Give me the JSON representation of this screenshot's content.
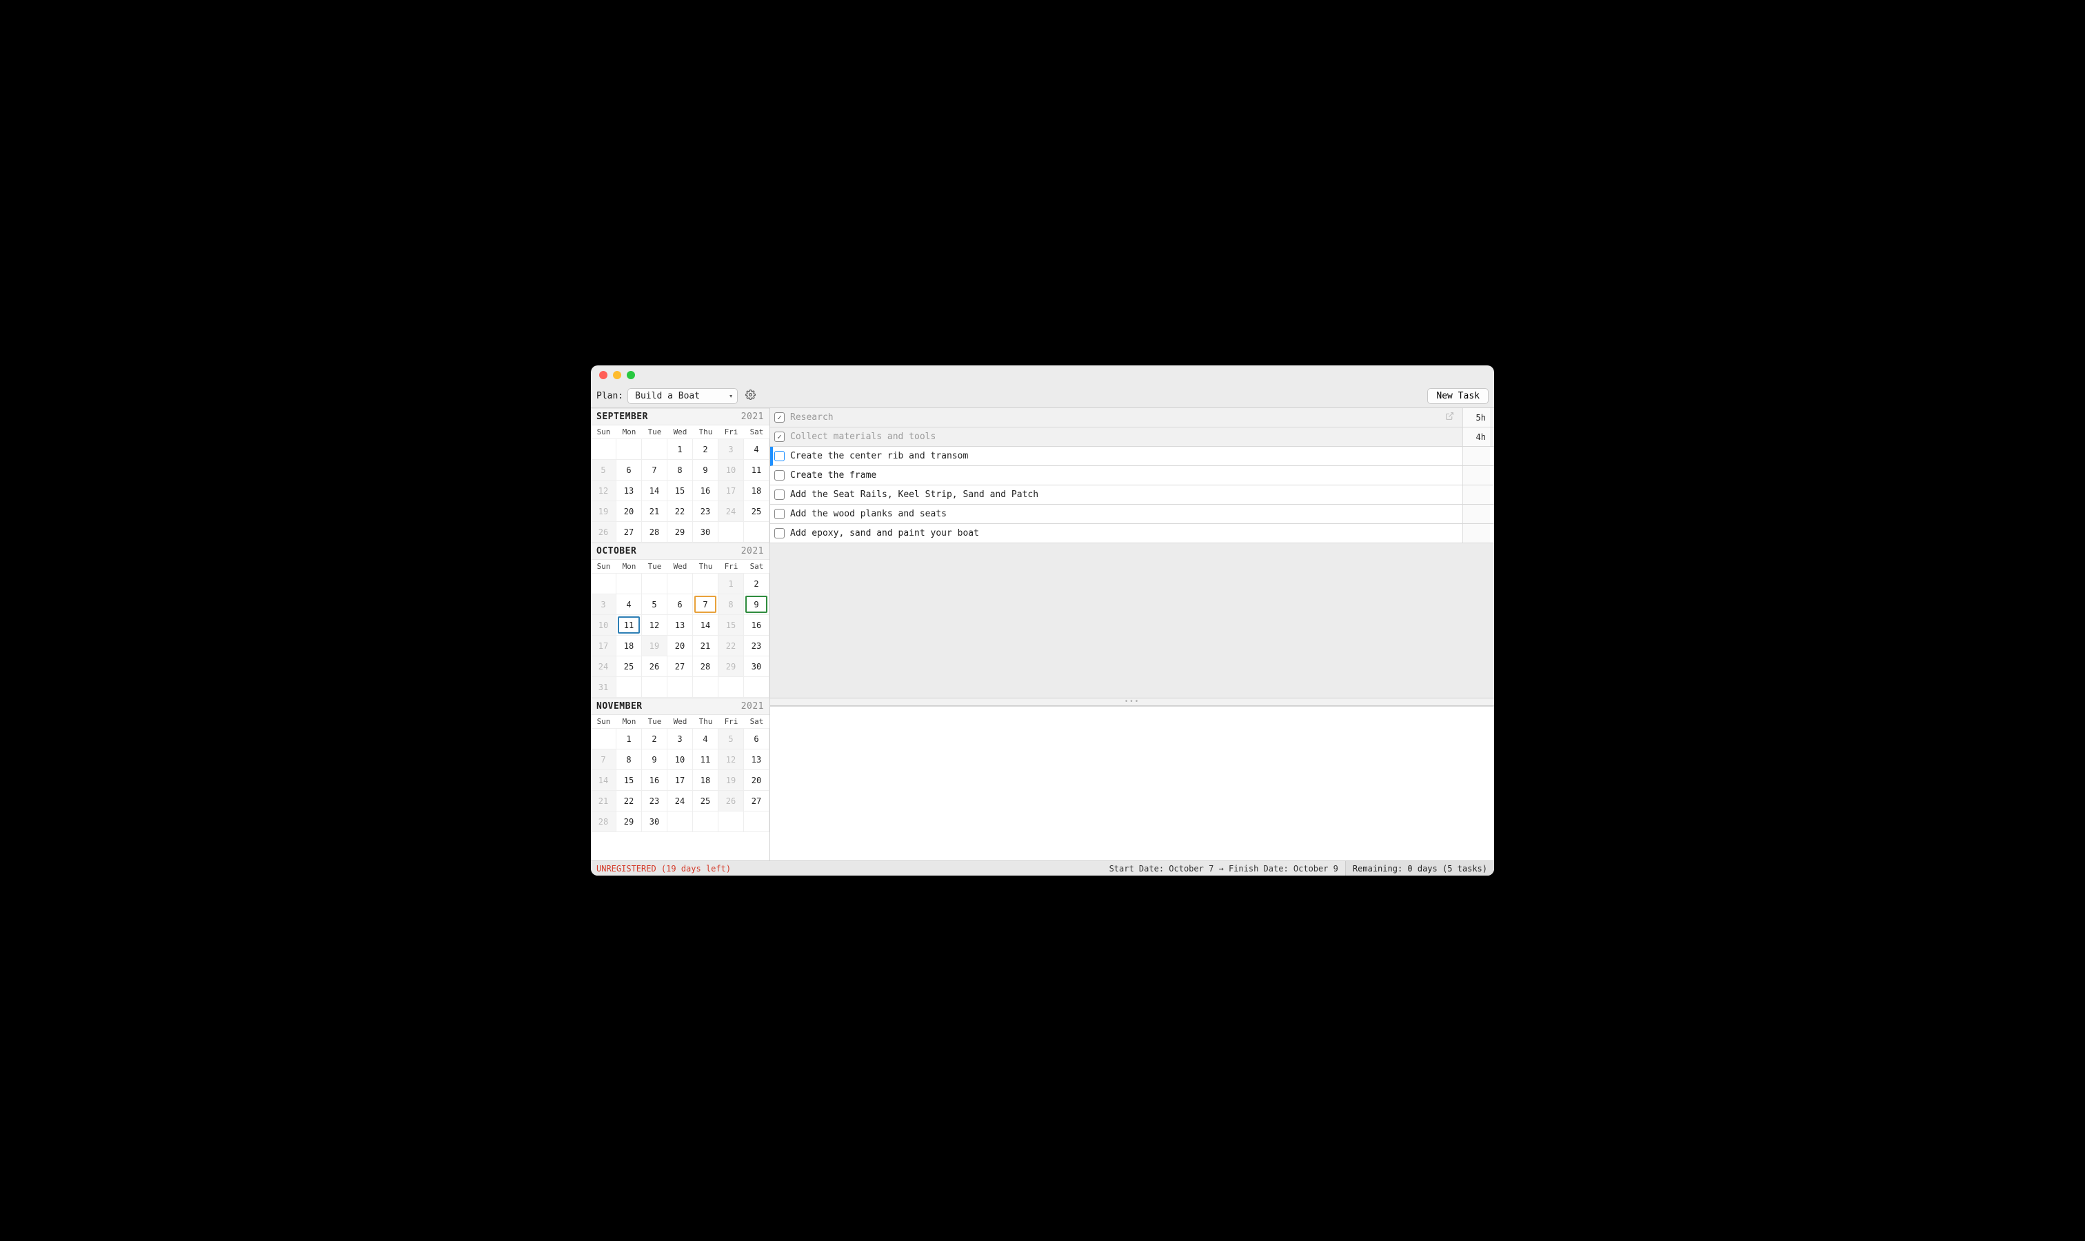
{
  "toolbar": {
    "plan_label": "Plan:",
    "plan_selected": "Build a Boat",
    "new_task_label": "New Task"
  },
  "dow": [
    "Sun",
    "Mon",
    "Tue",
    "Wed",
    "Thu",
    "Fri",
    "Sat"
  ],
  "months": [
    {
      "name": "SEPTEMBER",
      "year": "2021",
      "weeks": [
        [
          {
            "d": "",
            "cls": "empty"
          },
          {
            "d": "",
            "cls": "empty"
          },
          {
            "d": "",
            "cls": "empty"
          },
          {
            "d": "1"
          },
          {
            "d": "2"
          },
          {
            "d": "3",
            "cls": "dim"
          },
          {
            "d": "4"
          }
        ],
        [
          {
            "d": "5",
            "cls": "dim"
          },
          {
            "d": "6"
          },
          {
            "d": "7"
          },
          {
            "d": "8"
          },
          {
            "d": "9"
          },
          {
            "d": "10",
            "cls": "dim"
          },
          {
            "d": "11"
          }
        ],
        [
          {
            "d": "12",
            "cls": "dim"
          },
          {
            "d": "13"
          },
          {
            "d": "14"
          },
          {
            "d": "15"
          },
          {
            "d": "16"
          },
          {
            "d": "17",
            "cls": "dim"
          },
          {
            "d": "18"
          }
        ],
        [
          {
            "d": "19",
            "cls": "dim"
          },
          {
            "d": "20"
          },
          {
            "d": "21"
          },
          {
            "d": "22"
          },
          {
            "d": "23"
          },
          {
            "d": "24",
            "cls": "dim"
          },
          {
            "d": "25"
          }
        ],
        [
          {
            "d": "26",
            "cls": "dim"
          },
          {
            "d": "27"
          },
          {
            "d": "28"
          },
          {
            "d": "29"
          },
          {
            "d": "30"
          },
          {
            "d": "",
            "cls": "empty"
          },
          {
            "d": "",
            "cls": "empty"
          }
        ]
      ]
    },
    {
      "name": "OCTOBER",
      "year": "2021",
      "weeks": [
        [
          {
            "d": "",
            "cls": "empty"
          },
          {
            "d": "",
            "cls": "empty"
          },
          {
            "d": "",
            "cls": "empty"
          },
          {
            "d": "",
            "cls": "empty"
          },
          {
            "d": "",
            "cls": "empty"
          },
          {
            "d": "1",
            "cls": "dim"
          },
          {
            "d": "2"
          }
        ],
        [
          {
            "d": "3",
            "cls": "dim"
          },
          {
            "d": "4"
          },
          {
            "d": "5"
          },
          {
            "d": "6"
          },
          {
            "d": "7",
            "cls": "hl-orange"
          },
          {
            "d": "8",
            "cls": "dim"
          },
          {
            "d": "9",
            "cls": "hl-green"
          }
        ],
        [
          {
            "d": "10",
            "cls": "dim"
          },
          {
            "d": "11",
            "cls": "hl-blue"
          },
          {
            "d": "12"
          },
          {
            "d": "13"
          },
          {
            "d": "14"
          },
          {
            "d": "15",
            "cls": "dim"
          },
          {
            "d": "16"
          }
        ],
        [
          {
            "d": "17",
            "cls": "dim"
          },
          {
            "d": "18"
          },
          {
            "d": "19",
            "cls": "dim"
          },
          {
            "d": "20"
          },
          {
            "d": "21"
          },
          {
            "d": "22",
            "cls": "dim"
          },
          {
            "d": "23"
          }
        ],
        [
          {
            "d": "24",
            "cls": "dim"
          },
          {
            "d": "25"
          },
          {
            "d": "26"
          },
          {
            "d": "27"
          },
          {
            "d": "28"
          },
          {
            "d": "29",
            "cls": "dim"
          },
          {
            "d": "30"
          }
        ],
        [
          {
            "d": "31",
            "cls": "dim"
          },
          {
            "d": "",
            "cls": "empty"
          },
          {
            "d": "",
            "cls": "empty"
          },
          {
            "d": "",
            "cls": "empty"
          },
          {
            "d": "",
            "cls": "empty"
          },
          {
            "d": "",
            "cls": "empty"
          },
          {
            "d": "",
            "cls": "empty"
          }
        ]
      ]
    },
    {
      "name": "NOVEMBER",
      "year": "2021",
      "weeks": [
        [
          {
            "d": "",
            "cls": "empty"
          },
          {
            "d": "1"
          },
          {
            "d": "2"
          },
          {
            "d": "3"
          },
          {
            "d": "4"
          },
          {
            "d": "5",
            "cls": "dim"
          },
          {
            "d": "6"
          }
        ],
        [
          {
            "d": "7",
            "cls": "dim"
          },
          {
            "d": "8"
          },
          {
            "d": "9"
          },
          {
            "d": "10"
          },
          {
            "d": "11"
          },
          {
            "d": "12",
            "cls": "dim"
          },
          {
            "d": "13"
          }
        ],
        [
          {
            "d": "14",
            "cls": "dim"
          },
          {
            "d": "15"
          },
          {
            "d": "16"
          },
          {
            "d": "17"
          },
          {
            "d": "18"
          },
          {
            "d": "19",
            "cls": "dim"
          },
          {
            "d": "20"
          }
        ],
        [
          {
            "d": "21",
            "cls": "dim"
          },
          {
            "d": "22"
          },
          {
            "d": "23"
          },
          {
            "d": "24"
          },
          {
            "d": "25"
          },
          {
            "d": "26",
            "cls": "dim"
          },
          {
            "d": "27"
          }
        ],
        [
          {
            "d": "28",
            "cls": "dim"
          },
          {
            "d": "29"
          },
          {
            "d": "30"
          },
          {
            "d": "",
            "cls": "empty"
          },
          {
            "d": "",
            "cls": "empty"
          },
          {
            "d": "",
            "cls": "empty"
          },
          {
            "d": "",
            "cls": "empty"
          }
        ]
      ]
    }
  ],
  "tasks": [
    {
      "title": "Research",
      "done": true,
      "selected": false,
      "link": true,
      "duration": "5h"
    },
    {
      "title": "Collect materials and tools",
      "done": true,
      "selected": false,
      "link": false,
      "duration": "4h"
    },
    {
      "title": "Create the center rib and transom",
      "done": false,
      "selected": true,
      "link": false,
      "duration": ""
    },
    {
      "title": "Create the frame",
      "done": false,
      "selected": false,
      "link": false,
      "duration": ""
    },
    {
      "title": "Add the Seat Rails, Keel Strip, Sand and Patch",
      "done": false,
      "selected": false,
      "link": false,
      "duration": ""
    },
    {
      "title": "Add the wood planks and seats",
      "done": false,
      "selected": false,
      "link": false,
      "duration": ""
    },
    {
      "title": "Add epoxy, sand and paint your boat",
      "done": false,
      "selected": false,
      "link": false,
      "duration": ""
    }
  ],
  "status": {
    "unregistered": "UNREGISTERED (19 days left)",
    "dates": "Start Date: October 7 → Finish Date: October 9",
    "remaining": "Remaining: 0 days (5 tasks)"
  }
}
